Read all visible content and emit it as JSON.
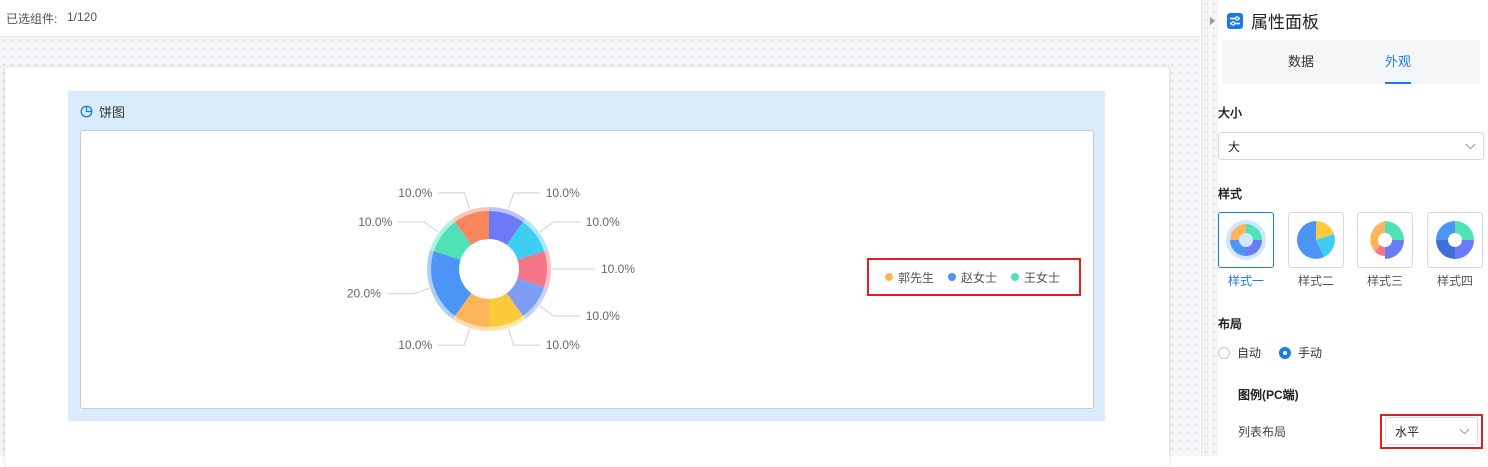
{
  "topbar": {
    "selected_label": "已选组件:",
    "selected_count": "1/120"
  },
  "widget": {
    "title": "饼图",
    "title_icon": "pie-chart-icon"
  },
  "chart_data": {
    "type": "pie",
    "donut": true,
    "slices": [
      {
        "label": "10.0%",
        "value": 10,
        "color": "#6b7bf7"
      },
      {
        "label": "10.0%",
        "value": 10,
        "color": "#3dcff2"
      },
      {
        "label": "10.0%",
        "value": 10,
        "color": "#f47588"
      },
      {
        "label": "10.0%",
        "value": 10,
        "color": "#7f9cf5"
      },
      {
        "label": "10.0%",
        "value": 10,
        "color": "#fdc93c"
      },
      {
        "label": "10.0%",
        "value": 10,
        "color": "#fdb45b"
      },
      {
        "label": "20.0%",
        "value": 20,
        "color": "#4d94f7"
      },
      {
        "label": "10.0%",
        "value": 10,
        "color": "#4fe2b7"
      },
      {
        "label": "10.0%",
        "value": 10,
        "color": "#f9855a"
      }
    ],
    "legend": [
      {
        "name": "郭先生",
        "color": "#fdb45b"
      },
      {
        "name": "赵女士",
        "color": "#4d94f7"
      },
      {
        "name": "王女士",
        "color": "#4fe2b7"
      }
    ],
    "legend_position": "right"
  },
  "panel": {
    "title": "属性面板",
    "title_icon": "sliders-icon",
    "tabs": [
      {
        "label": "数据"
      },
      {
        "label": "外观",
        "active": true
      }
    ],
    "size": {
      "label": "大小",
      "value": "大"
    },
    "style": {
      "label": "样式",
      "options": [
        {
          "label": "样式一",
          "selected": true
        },
        {
          "label": "样式二"
        },
        {
          "label": "样式三"
        },
        {
          "label": "样式四"
        }
      ]
    },
    "layout": {
      "label": "布局",
      "options": [
        "自动",
        "手动"
      ],
      "selected": "手动"
    },
    "legend": {
      "label": "图例(PC端)",
      "list_layout_label": "列表布局",
      "list_layout_value": "水平"
    }
  }
}
